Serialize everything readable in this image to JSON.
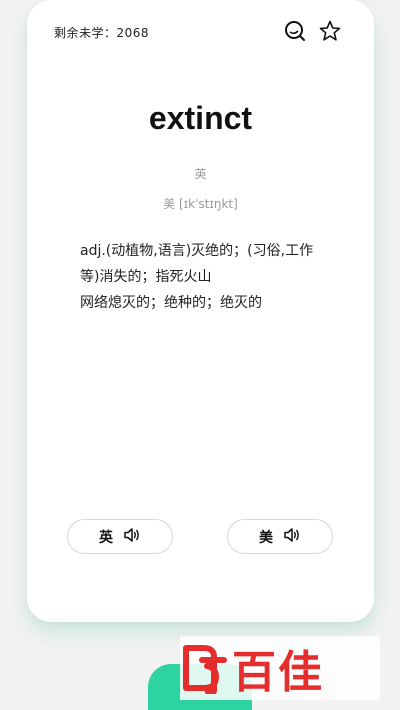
{
  "header": {
    "remaining_label": "剩余未学：2068",
    "search_icon": "search-icon",
    "star_icon": "star-icon"
  },
  "word": {
    "text": "extinct",
    "accent_label": "英",
    "phonetic": "美 [ɪkˈstɪŋkt]"
  },
  "definitions": [
    "adj.(动植物,语言)灭绝的；(习俗,工作等)消失的；指死火山",
    "网络熄灭的；绝种的；绝灭的"
  ],
  "pronunciation": {
    "uk_label": "英",
    "us_label": "美",
    "icon": "speaker-icon"
  },
  "watermark": {
    "text": "百佳"
  },
  "colors": {
    "accent_green": "#2dd3a0",
    "watermark_red": "#e62d2d"
  }
}
